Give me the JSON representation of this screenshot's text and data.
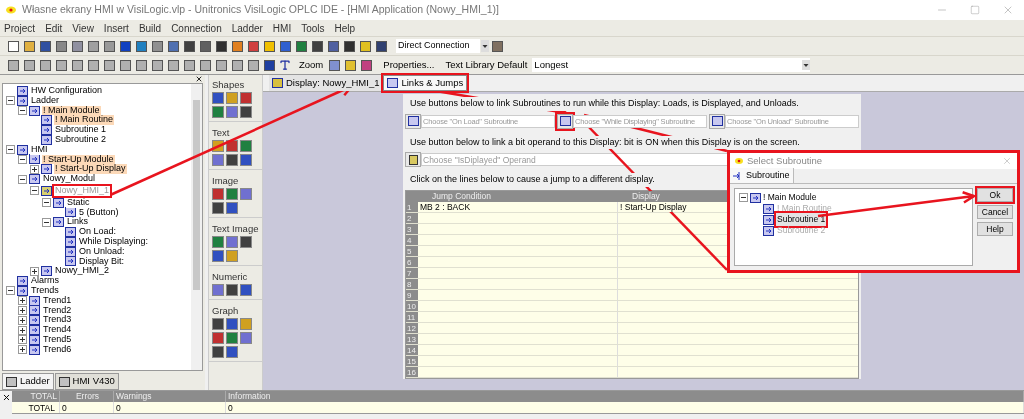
{
  "window": {
    "title": "Własne ekrany HMI w VisiLogic.vlp - Unitronics VisiLogic OPLC IDE - [HMI Application (Nowy_HMI_1)]"
  },
  "menu": [
    "Project",
    "Edit",
    "View",
    "Insert",
    "Build",
    "Connection",
    "Ladder",
    "HMI",
    "Tools",
    "Help"
  ],
  "toolbar": {
    "connection": "Direct Connection",
    "zoom_label": "Zoom",
    "properties": "Properties...",
    "text_library_label": "Text Library Default",
    "text_library": "Longest"
  },
  "tree": [
    {
      "label": "HW Configuration",
      "highlighted": false,
      "dimmed": false,
      "annotated": false
    },
    {
      "label": "Ladder",
      "highlighted": false,
      "dimmed": false,
      "annotated": false,
      "expanded": true,
      "children": [
        {
          "label": "! Main Module",
          "highlighted": true,
          "dimmed": false,
          "annotated": false,
          "expanded": true,
          "children": [
            {
              "label": "! Main Routine",
              "highlighted": true,
              "dimmed": false,
              "annotated": false
            },
            {
              "label": "Subroutine 1",
              "highlighted": false,
              "dimmed": false,
              "annotated": false
            },
            {
              "label": "Subroutine 2",
              "highlighted": false,
              "dimmed": false,
              "annotated": false
            }
          ]
        }
      ]
    },
    {
      "label": "HMI",
      "highlighted": false,
      "dimmed": false,
      "annotated": false,
      "expanded": true,
      "children": [
        {
          "label": "! Start-Up Module",
          "highlighted": true,
          "dimmed": false,
          "annotated": false,
          "expanded": true,
          "children": [
            {
              "label": "! Start-Up Display",
              "highlighted": true,
              "dimmed": false,
              "annotated": false,
              "expanded": false
            }
          ]
        },
        {
          "label": "Nowy_Modul",
          "highlighted": false,
          "dimmed": false,
          "annotated": false,
          "expanded": true,
          "children": [
            {
              "label": "Nowy_HMI_1",
              "highlighted": false,
              "dimmed": true,
              "annotated": true,
              "expanded": true,
              "children": [
                {
                  "label": "Static",
                  "highlighted": false,
                  "dimmed": false,
                  "annotated": false,
                  "expanded": true,
                  "children": [
                    {
                      "label": "5 (Button)",
                      "highlighted": false,
                      "dimmed": false,
                      "annotated": false
                    }
                  ]
                },
                {
                  "label": "Links",
                  "highlighted": false,
                  "dimmed": false,
                  "annotated": false,
                  "expanded": true,
                  "children": [
                    {
                      "label": "On Load:",
                      "highlighted": false,
                      "dimmed": false,
                      "annotated": false
                    },
                    {
                      "label": "While Displaying:",
                      "highlighted": false,
                      "dimmed": false,
                      "annotated": false
                    },
                    {
                      "label": "On Unload:",
                      "highlighted": false,
                      "dimmed": false,
                      "annotated": false
                    },
                    {
                      "label": "Display Bit:",
                      "highlighted": false,
                      "dimmed": false,
                      "annotated": false
                    }
                  ]
                }
              ]
            },
            {
              "label": "Nowy_HMI_2",
              "highlighted": false,
              "dimmed": false,
              "annotated": false,
              "expanded": false
            }
          ]
        }
      ]
    },
    {
      "label": "Alarms",
      "highlighted": false,
      "dimmed": false,
      "annotated": false
    },
    {
      "label": "Trends",
      "highlighted": false,
      "dimmed": false,
      "annotated": false,
      "expanded": true,
      "children": [
        {
          "label": "Trend1",
          "highlighted": false,
          "dimmed": false,
          "annotated": false,
          "expanded": false
        },
        {
          "label": "Trend2",
          "highlighted": false,
          "dimmed": false,
          "annotated": false,
          "expanded": false
        },
        {
          "label": "Trend3",
          "highlighted": false,
          "dimmed": false,
          "annotated": false,
          "expanded": false
        },
        {
          "label": "Trend4",
          "highlighted": false,
          "dimmed": false,
          "annotated": false,
          "expanded": false
        },
        {
          "label": "Trend5",
          "highlighted": false,
          "dimmed": false,
          "annotated": false,
          "expanded": false
        },
        {
          "label": "Trend6",
          "highlighted": false,
          "dimmed": false,
          "annotated": false,
          "expanded": false
        }
      ]
    }
  ],
  "left_tabs": [
    {
      "label": "Ladder",
      "selected": true
    },
    {
      "label": "HMI V430",
      "selected": false
    }
  ],
  "palette": [
    "Shapes",
    "Text",
    "Image",
    "Text Image",
    "Numeric",
    "Graph"
  ],
  "doc_tabs": [
    {
      "label": "Display: Nowy_HMI_1",
      "selected": false,
      "annotated": false
    },
    {
      "label": "Links & Jumps",
      "selected": true,
      "annotated": true
    }
  ],
  "links": {
    "legend": "Use buttons below to link Subroutines to run while this Display:  Loads, is Displayed, and Unloads.",
    "fields": [
      {
        "placeholder": "Choose \"On Load\" Subroutine",
        "annotated": false
      },
      {
        "placeholder": "Choose \"While Displaying\" Subroutine",
        "annotated": true
      },
      {
        "placeholder": "Choose \"On Unload\" Subroutine",
        "annotated": false
      }
    ],
    "operand_legend": "Use button below to link a bit operand to this Display: bit is ON when this Display is on the screen.",
    "operand_placeholder": "Choose \"IsDiplayed\" Operand"
  },
  "jumps": {
    "legend": "Click on the lines below to cause a jump to a different display.",
    "columns": [
      "Jump Condition",
      "Display"
    ],
    "rows": [
      {
        "number": "1",
        "cells": [
          "MB 2 : BACK",
          "! Start-Up Display"
        ]
      },
      {
        "number": "2",
        "cells": []
      },
      {
        "number": "3",
        "cells": []
      },
      {
        "number": "4",
        "cells": []
      },
      {
        "number": "5",
        "cells": []
      },
      {
        "number": "6",
        "cells": []
      },
      {
        "number": "7",
        "cells": []
      },
      {
        "number": "8",
        "cells": []
      },
      {
        "number": "9",
        "cells": []
      },
      {
        "number": "10",
        "cells": []
      },
      {
        "number": "11",
        "cells": []
      },
      {
        "number": "12",
        "cells": []
      },
      {
        "number": "13",
        "cells": []
      },
      {
        "number": "14",
        "cells": []
      },
      {
        "number": "15",
        "cells": []
      },
      {
        "number": "16",
        "cells": []
      }
    ]
  },
  "dialog": {
    "title": "Select Subroutine",
    "tab": "Subroutine",
    "annotated": true,
    "root": {
      "label": "! Main Module",
      "children": [
        {
          "label": "! Main Routine",
          "selected": false,
          "dimmed": true,
          "annotated": false
        },
        {
          "label": "Subroutine 1",
          "selected": true,
          "dimmed": false,
          "annotated": true
        },
        {
          "label": "Subroutine 2",
          "selected": false,
          "dimmed": true,
          "annotated": false
        }
      ]
    },
    "buttons": [
      {
        "label": "Ok",
        "annotated": true
      },
      {
        "label": "Cancel",
        "annotated": false
      },
      {
        "label": "Help",
        "annotated": false
      }
    ]
  },
  "output": {
    "columns": [
      "TOTAL",
      "Errors",
      "Warnings",
      "Information"
    ],
    "row": [
      "TOTAL",
      "0",
      "0",
      "0"
    ]
  }
}
